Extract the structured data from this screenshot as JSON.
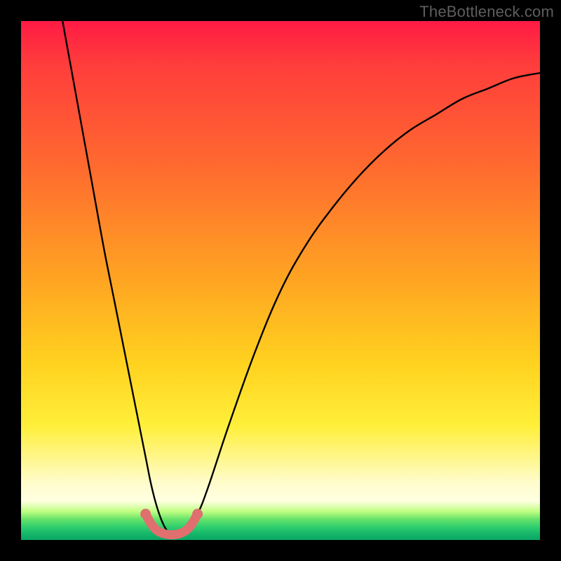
{
  "watermark": "TheBottleneck.com",
  "chart_data": {
    "type": "line",
    "title": "",
    "xlabel": "",
    "ylabel": "",
    "xlim": [
      0,
      100
    ],
    "ylim": [
      0,
      100
    ],
    "grid": false,
    "legend": false,
    "series": [
      {
        "name": "bottleneck-curve",
        "color": "#000000",
        "x": [
          8,
          10,
          12,
          14,
          16,
          18,
          20,
          22,
          24,
          25,
          26,
          27,
          28,
          29,
          30,
          31,
          32,
          34,
          36,
          40,
          45,
          50,
          55,
          60,
          65,
          70,
          75,
          80,
          85,
          90,
          95,
          100
        ],
        "y": [
          100,
          89,
          78,
          67,
          56,
          46,
          36,
          26,
          16,
          11,
          7,
          4,
          2,
          1.3,
          1,
          1.3,
          2,
          5,
          10,
          22,
          36,
          48,
          57,
          64,
          70,
          75,
          79,
          82,
          85,
          87,
          89,
          90
        ]
      },
      {
        "name": "optimal-marker",
        "color": "#e06f6f",
        "x": [
          24,
          25,
          26,
          27,
          28,
          29,
          30,
          31,
          32,
          33,
          34
        ],
        "y": [
          5,
          3.2,
          2.0,
          1.4,
          1.1,
          1.0,
          1.1,
          1.4,
          2.0,
          3.2,
          5
        ]
      }
    ],
    "background_gradient": {
      "type": "vertical",
      "stops": [
        {
          "pos": 0.0,
          "color": "#ff1a44"
        },
        {
          "pos": 0.08,
          "color": "#ff3c3c"
        },
        {
          "pos": 0.28,
          "color": "#ff6a2f"
        },
        {
          "pos": 0.5,
          "color": "#ffa522"
        },
        {
          "pos": 0.66,
          "color": "#ffd21f"
        },
        {
          "pos": 0.78,
          "color": "#ffef3a"
        },
        {
          "pos": 0.89,
          "color": "#fffccc"
        },
        {
          "pos": 0.925,
          "color": "#ffffe0"
        },
        {
          "pos": 0.945,
          "color": "#bfff82"
        },
        {
          "pos": 0.96,
          "color": "#67e26a"
        },
        {
          "pos": 0.975,
          "color": "#2fcf6e"
        },
        {
          "pos": 0.987,
          "color": "#17b86b"
        },
        {
          "pos": 1.0,
          "color": "#0aa765"
        }
      ]
    }
  }
}
